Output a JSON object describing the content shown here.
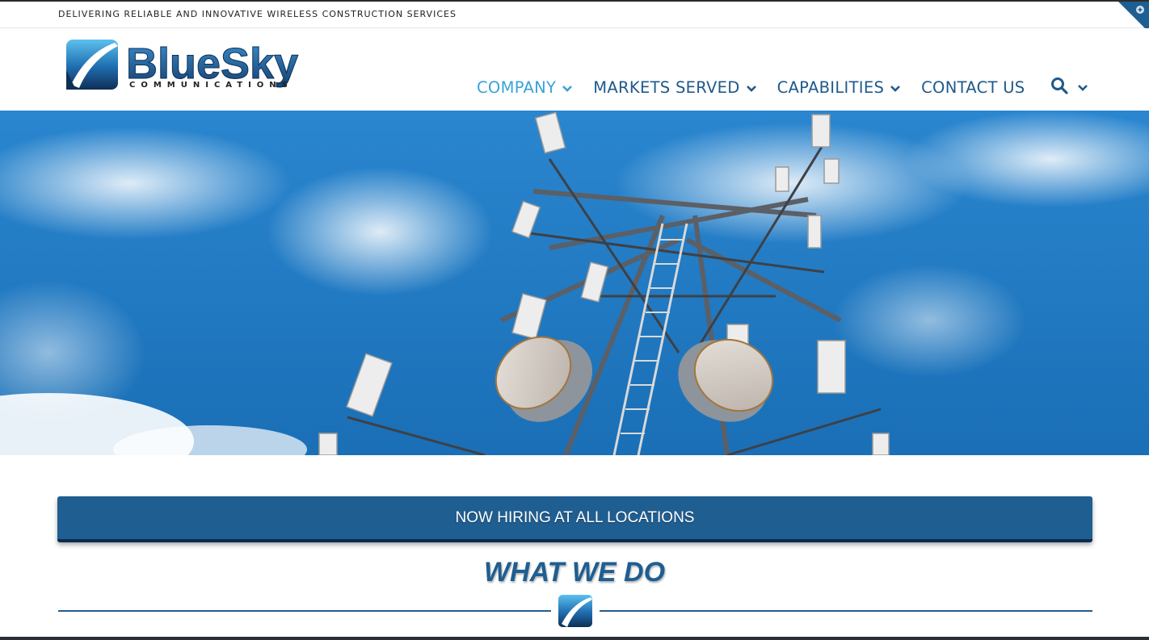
{
  "topbar": {
    "tagline": "DELIVERING RELIABLE AND INNOVATIVE WIRELESS CONSTRUCTION SERVICES"
  },
  "logo": {
    "name": "BlueSky",
    "sub": "COMMUNICATIONS"
  },
  "nav": {
    "items": [
      {
        "label": "COMPANY",
        "active": true,
        "dropdown": true
      },
      {
        "label": "MARKETS SERVED",
        "active": false,
        "dropdown": true
      },
      {
        "label": "CAPABILITIES",
        "active": false,
        "dropdown": true
      },
      {
        "label": "CONTACT US",
        "active": false,
        "dropdown": false
      }
    ],
    "search_icon": "search-icon"
  },
  "hero": {
    "image": "cell-tower-against-blue-sky"
  },
  "banner": {
    "label": "NOW HIRING AT ALL LOCATIONS"
  },
  "section": {
    "title": "WHAT WE DO"
  },
  "colors": {
    "primary": "#1f5e91",
    "accent": "#3aa3d8",
    "nav_text": "#1f5a8b",
    "sky": "#1e78c0"
  }
}
